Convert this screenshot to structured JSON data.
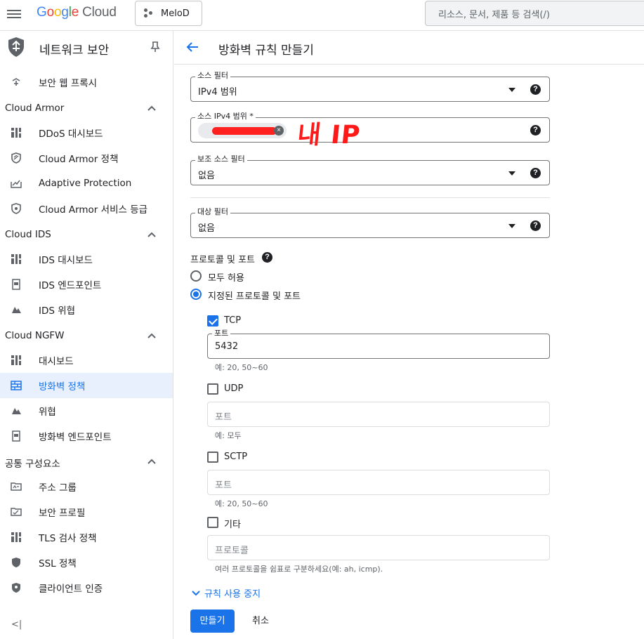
{
  "topbar": {
    "logo_parts": [
      "G",
      "o",
      "o",
      "g",
      "l",
      "e"
    ],
    "logo_suffix": "Cloud",
    "project": "MeloD",
    "search_placeholder": "리소스, 문서, 제품 등 검색(/)"
  },
  "sidebar": {
    "title": "네트워크 보안",
    "top_item": "보안 웹 프록시",
    "sections": [
      {
        "label": "Cloud Armor",
        "items": [
          "DDoS 대시보드",
          "Cloud Armor 정책",
          "Adaptive Protection",
          "Cloud Armor 서비스 등급"
        ]
      },
      {
        "label": "Cloud IDS",
        "items": [
          "IDS 대시보드",
          "IDS 엔드포인트",
          "IDS 위협"
        ]
      },
      {
        "label": "Cloud NGFW",
        "items": [
          "대시보드",
          "방화벽 정책",
          "위협",
          "방화벽 엔드포인트"
        ]
      },
      {
        "label": "공통 구성요소",
        "items": [
          "주소 그룹",
          "보안 프로필",
          "TLS 검사 정책",
          "SSL 정책",
          "클라이언트 인증"
        ]
      }
    ],
    "active_item": "방화벽 정책",
    "collapse_label": "<|"
  },
  "page": {
    "title": "방화벽 규칙 만들기"
  },
  "form": {
    "source_filter": {
      "label": "소스 필터",
      "value": "IPv4 범위"
    },
    "source_ipv4": {
      "label": "소스 IPv4 범위 *",
      "annotation": "내 IP"
    },
    "secondary_source_filter": {
      "label": "보조 소스 필터",
      "value": "없음"
    },
    "target_filter": {
      "label": "대상 필터",
      "value": "없음"
    },
    "protocols": {
      "label": "프로토콜 및 포트",
      "allow_all": "모두 허용",
      "specified": "지정된 프로토콜 및 포트",
      "tcp": {
        "label": "TCP",
        "port_label": "포트",
        "port_value": "5432",
        "hint": "예: 20, 50~60"
      },
      "udp": {
        "label": "UDP",
        "placeholder": "포트",
        "hint": "예: 모두"
      },
      "sctp": {
        "label": "SCTP",
        "placeholder": "포트",
        "hint": "예: 20, 50~60"
      },
      "other": {
        "label": "기타",
        "placeholder": "프로토콜",
        "hint": "여러 프로토콜을 쉼표로 구분하세요(예: ah, icmp)."
      }
    },
    "disable_rule": "규칙 사용 중지",
    "create_button": "만들기",
    "cancel_button": "취소"
  },
  "colors": {
    "accent": "#1a73e8",
    "active_bg": "#e8f0fe",
    "annotation": "#ff1a1a"
  }
}
